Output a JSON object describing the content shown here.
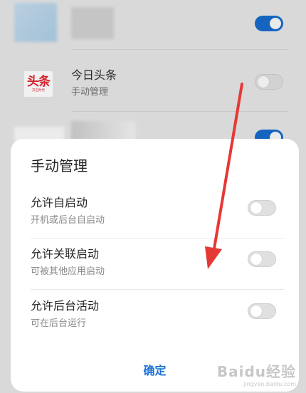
{
  "background_list": {
    "app": {
      "icon_text_big": "头条",
      "icon_text_small": "开启时代",
      "name": "今日头条",
      "status": "手动管理",
      "toggle_on": false
    }
  },
  "dialog": {
    "title": "手动管理",
    "options": [
      {
        "label": "允许自启动",
        "description": "开机或后台自启动",
        "enabled": false
      },
      {
        "label": "允许关联启动",
        "description": "可被其他应用启动",
        "enabled": false
      },
      {
        "label": "允许后台活动",
        "description": "可在后台运行",
        "enabled": false
      }
    ],
    "confirm_label": "确定"
  },
  "watermark": {
    "brand": "Baidu经验",
    "url": "jingyan.baidu.com"
  },
  "colors": {
    "accent": "#1c73d6",
    "toggle_on": "#1565c0",
    "annotation": "#e53935"
  }
}
